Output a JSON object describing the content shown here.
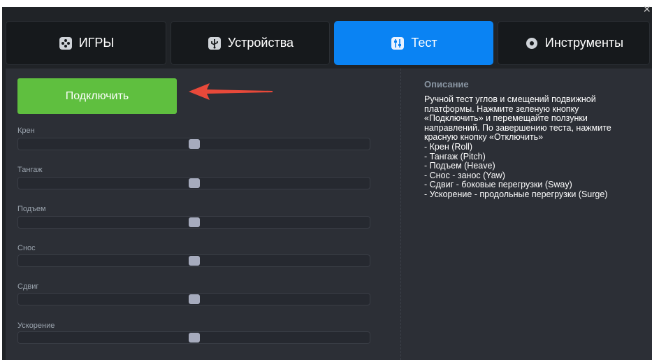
{
  "window": {
    "close_glyph": "×"
  },
  "tabs": [
    {
      "label": "ИГРЫ",
      "icon": "gamepad-icon",
      "active": false
    },
    {
      "label": "Устройства",
      "icon": "usb-icon",
      "active": false
    },
    {
      "label": "Тест",
      "icon": "sliders-icon",
      "active": true
    },
    {
      "label": "Инструменты",
      "icon": "gear-icon",
      "active": false
    }
  ],
  "colors": {
    "active_tab": "#0a83f3",
    "connect_button": "#5fbf3f",
    "arrow": "#e8493a"
  },
  "connect_label": "Подключить",
  "sliders": [
    {
      "label": "Крен",
      "value": 0.5
    },
    {
      "label": "Тангаж",
      "value": 0.5
    },
    {
      "label": "Подъем",
      "value": 0.5
    },
    {
      "label": "Снос",
      "value": 0.5
    },
    {
      "label": "Сдвиг",
      "value": 0.5
    },
    {
      "label": "Ускорение",
      "value": 0.5
    }
  ],
  "description": {
    "title": "Описание",
    "lines": [
      "Ручной тест углов и смещений подвижной",
      "платформы.  Нажмите зеленую кнопку",
      "«Подключить» и перемещайте ползунки",
      "направлений. По завершению теста, нажмите",
      "красную кнопку «Отключить»",
      "- Крен (Roll)",
      "- Тангаж (Pitch)",
      "- Подъем (Heave)",
      "- Снос - занос (Yaw)",
      "- Сдвиг - боковые перегрузки (Sway)",
      "- Ускорение - продольные перегрузки (Surge)"
    ]
  }
}
